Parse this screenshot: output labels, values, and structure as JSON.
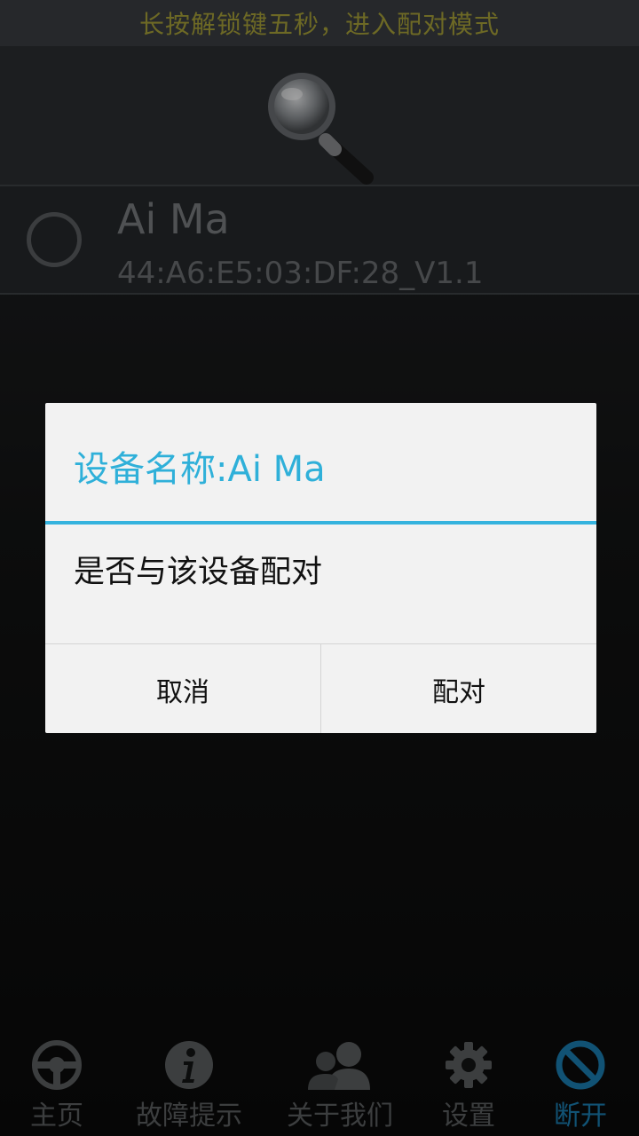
{
  "banner": {
    "text": "长按解锁键五秒，进入配对模式"
  },
  "device": {
    "name": "Ai Ma",
    "address": "44:A6:E5:03:DF:28_V1.1"
  },
  "dialog": {
    "title": "设备名称:Ai Ma",
    "message": "是否与该设备配对",
    "cancel_label": "取消",
    "confirm_label": "配对"
  },
  "nav": {
    "items": [
      {
        "label": "主页",
        "icon": "steering-wheel-icon"
      },
      {
        "label": "故障提示",
        "icon": "info-icon"
      },
      {
        "label": "关于我们",
        "icon": "users-icon"
      },
      {
        "label": "设置",
        "icon": "gear-icon"
      },
      {
        "label": "断开",
        "icon": "disconnect-icon",
        "active": true
      }
    ]
  },
  "colors": {
    "accent": "#35b3de",
    "banner_text": "#a8a23a",
    "active_nav": "#1b7fb3"
  }
}
